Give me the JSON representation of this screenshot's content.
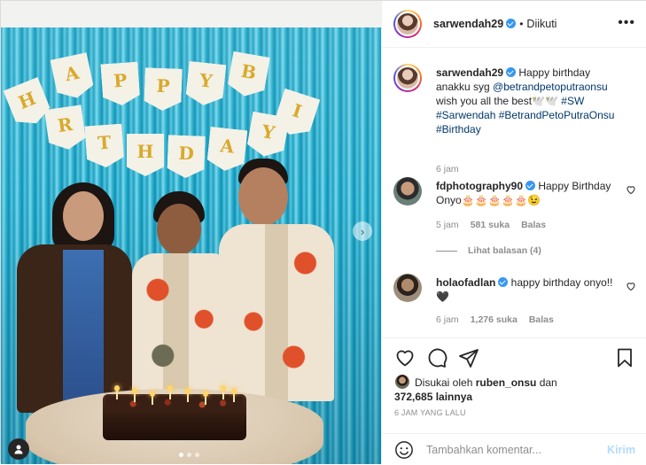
{
  "post": {
    "username": "sarwendah29",
    "separator": "•",
    "follow_status": "Diikuti",
    "more_icon": "more-horizontal-icon",
    "banner_letters": [
      "H",
      "A",
      "P",
      "P",
      "Y",
      "B",
      "I",
      "R",
      "T",
      "H",
      "D",
      "A",
      "Y"
    ],
    "carousel_total": 3,
    "carousel_active": 1
  },
  "caption": {
    "username": "sarwendah29",
    "text_1": " Happy birthday anakku syg ",
    "mention": "@betrandpetoputraonsu",
    "text_2": " wish you all the best🕊️🕊️ ",
    "hashtags": "#SW #Sarwendah #BetrandPetoPutraOnsu #Birthday",
    "time": "6 jam"
  },
  "comments": [
    {
      "username": "fdphotography90",
      "text": " Happy Birthday Onyo🎂🎂🎂🎂🎂😉",
      "time": "5 jam",
      "likes": "581 suka",
      "reply": "Balas",
      "replies_link": "Lihat balasan (4)"
    },
    {
      "username": "holaofadlan",
      "text": " happy birthday onyo!!🖤",
      "time": "6 jam",
      "likes": "1,276 suka",
      "reply": "Balas"
    }
  ],
  "likes": {
    "prefix": "Disukai oleh ",
    "user": "ruben_onsu",
    "middle": " dan",
    "count": "372,685 lainnya"
  },
  "timestamp": "6 JAM YANG LALU",
  "add_comment": {
    "placeholder": "Tambahkan komentar...",
    "post_label": "Kirim"
  },
  "colors": {
    "link": "#00376b",
    "verified": "#3897f0",
    "post_disabled": "#b3dbff",
    "curtain": "#2bb3cf"
  }
}
